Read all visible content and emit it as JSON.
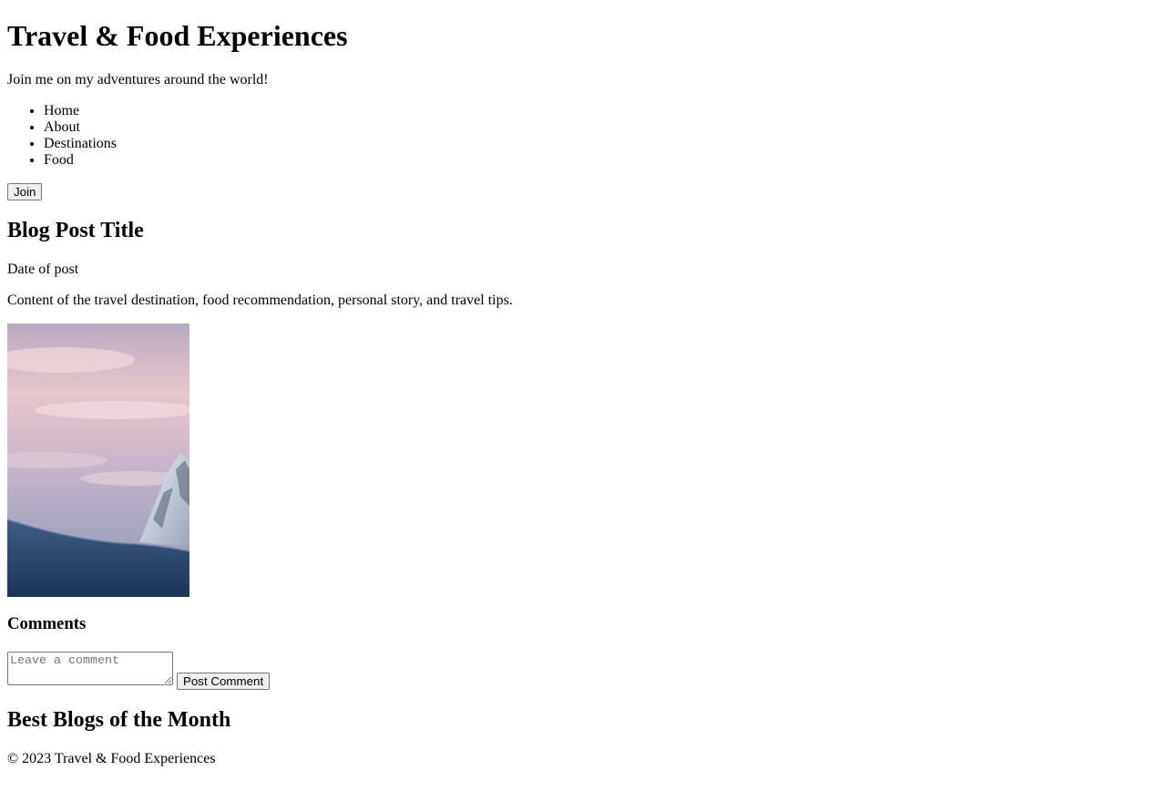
{
  "header": {
    "title": "Travel & Food Experiences",
    "tagline": "Join me on my adventures around the world!",
    "nav": [
      {
        "label": "Home"
      },
      {
        "label": "About"
      },
      {
        "label": "Destinations"
      },
      {
        "label": "Food"
      }
    ],
    "join_label": "Join"
  },
  "post": {
    "title": "Blog Post Title",
    "date": "Date of post",
    "content": "Content of the travel destination, food recommendation, personal story, and travel tips.",
    "image_icon": "mountain-sunset-photo"
  },
  "comments": {
    "heading": "Comments",
    "placeholder": "Leave a comment",
    "submit_label": "Post Comment"
  },
  "best_blogs": {
    "heading": "Best Blogs of the Month"
  },
  "footer": {
    "copyright": "© 2023 Travel & Food Experiences"
  }
}
